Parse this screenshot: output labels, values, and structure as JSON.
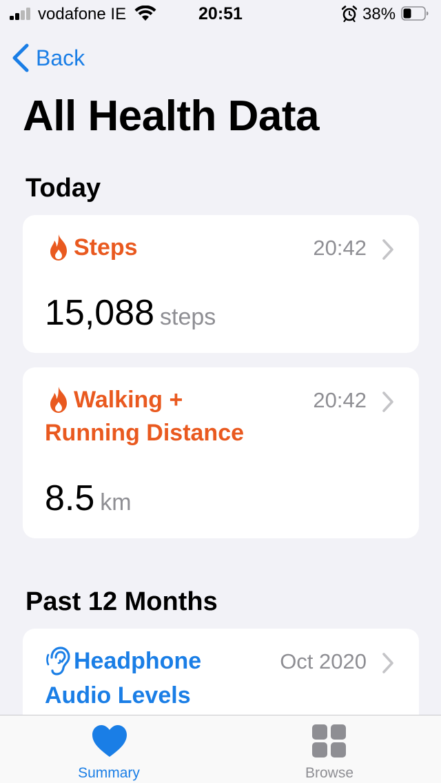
{
  "status_bar": {
    "carrier": "vodafone IE",
    "time": "20:51",
    "battery": "38%",
    "battery_level": 0.38
  },
  "nav": {
    "back_label": "Back",
    "title": "All Health Data"
  },
  "sections": [
    {
      "title": "Today",
      "cards": [
        {
          "title": "Steps",
          "time": "20:42",
          "value": "15,088",
          "unit": "steps",
          "icon": "flame-icon",
          "color": "#e9591f"
        },
        {
          "title_line1": "Walking +",
          "title_line2": "Running Distance",
          "time": "20:42",
          "value": "8.5",
          "unit": "km",
          "icon": "flame-icon",
          "color": "#e9591f"
        }
      ]
    },
    {
      "title": "Past 12 Months",
      "cards": [
        {
          "title_line1": "Headphone",
          "title_line2": "Audio Levels",
          "time": "Oct 2020",
          "icon": "ear-icon",
          "color": "#1a7ee6"
        }
      ]
    }
  ],
  "tab_bar": {
    "items": [
      {
        "label": "Summary",
        "icon": "heart-icon",
        "active": true,
        "color": "#1a7ee6"
      },
      {
        "label": "Browse",
        "icon": "grid-icon",
        "active": false,
        "color": "#8e8e93"
      }
    ]
  }
}
